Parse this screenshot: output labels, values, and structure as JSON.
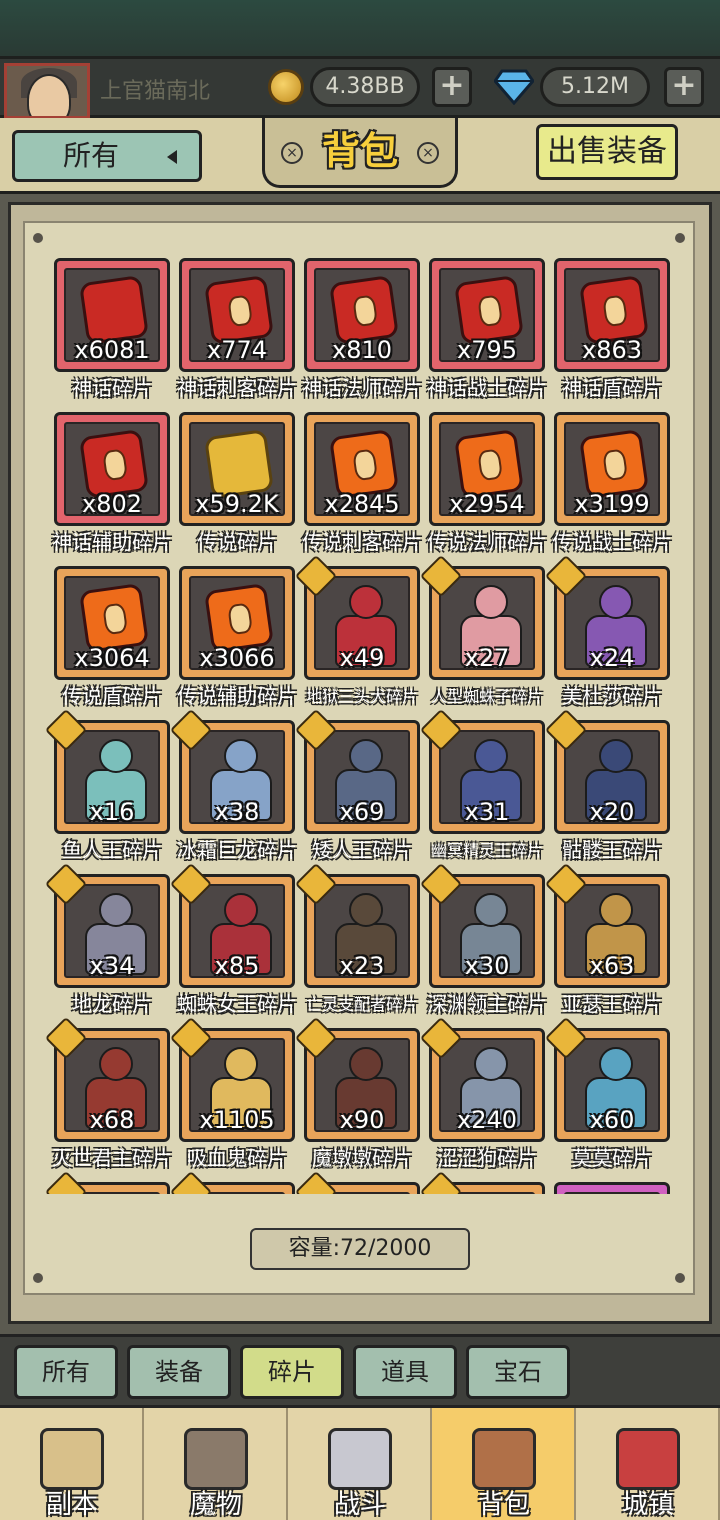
{
  "header": {
    "username": "上官猫南北",
    "gold": "4.38BB",
    "gems": "5.12M",
    "plus": "+"
  },
  "toolbar": {
    "filter_label": "所有",
    "title": "背包",
    "sell_label": "出售装备"
  },
  "inventory": {
    "items": [
      {
        "name": "神话碎片",
        "count": "x6081",
        "rarity": "mythic",
        "kind": "piece",
        "color": "red"
      },
      {
        "name": "神话刺客碎片",
        "count": "x774",
        "rarity": "mythic",
        "kind": "piece",
        "color": "red"
      },
      {
        "name": "神话法师碎片",
        "count": "x810",
        "rarity": "mythic",
        "kind": "piece",
        "color": "red"
      },
      {
        "name": "神话战士碎片",
        "count": "x795",
        "rarity": "mythic",
        "kind": "piece",
        "color": "red"
      },
      {
        "name": "神话盾碎片",
        "count": "x863",
        "rarity": "mythic",
        "kind": "piece",
        "color": "red"
      },
      {
        "name": "神话辅助碎片",
        "count": "x802",
        "rarity": "mythic",
        "kind": "piece",
        "color": "red"
      },
      {
        "name": "传说碎片",
        "count": "x59.2K",
        "rarity": "legend",
        "kind": "piece",
        "color": "gold"
      },
      {
        "name": "传说刺客碎片",
        "count": "x2845",
        "rarity": "legend",
        "kind": "piece",
        "color": "orange"
      },
      {
        "name": "传说法师碎片",
        "count": "x2954",
        "rarity": "legend",
        "kind": "piece",
        "color": "orange"
      },
      {
        "name": "传说战士碎片",
        "count": "x3199",
        "rarity": "legend",
        "kind": "piece",
        "color": "orange"
      },
      {
        "name": "传说盾碎片",
        "count": "x3064",
        "rarity": "legend",
        "kind": "piece",
        "color": "orange"
      },
      {
        "name": "传说辅助碎片",
        "count": "x3066",
        "rarity": "legend",
        "kind": "piece",
        "color": "orange"
      },
      {
        "name": "地狱三头犬碎片",
        "count": "x49",
        "rarity": "legend",
        "kind": "hero",
        "color": "#c2303a"
      },
      {
        "name": "人型蜘蛛子碎片",
        "count": "x27",
        "rarity": "legend",
        "kind": "hero",
        "color": "#e8a0a8"
      },
      {
        "name": "美杜莎碎片",
        "count": "x24",
        "rarity": "legend",
        "kind": "hero",
        "color": "#8a5ab8"
      },
      {
        "name": "鱼人王碎片",
        "count": "x16",
        "rarity": "legend",
        "kind": "hero",
        "color": "#7ec6c2"
      },
      {
        "name": "冰霜巨龙碎片",
        "count": "x38",
        "rarity": "legend",
        "kind": "hero",
        "color": "#8aa8d0"
      },
      {
        "name": "矮人王碎片",
        "count": "x69",
        "rarity": "legend",
        "kind": "hero",
        "color": "#5a6a8a"
      },
      {
        "name": "幽冥精灵王碎片",
        "count": "x31",
        "rarity": "legend",
        "kind": "hero",
        "color": "#4a5a9a"
      },
      {
        "name": "骷髅王碎片",
        "count": "x20",
        "rarity": "legend",
        "kind": "hero",
        "color": "#3a4a7a"
      },
      {
        "name": "地龙碎片",
        "count": "x34",
        "rarity": "legend",
        "kind": "hero",
        "color": "#8a8aa0"
      },
      {
        "name": "蜘蛛女王碎片",
        "count": "x85",
        "rarity": "legend",
        "kind": "hero",
        "color": "#b0303a"
      },
      {
        "name": "亡灵支配者碎片",
        "count": "x23",
        "rarity": "legend",
        "kind": "hero",
        "color": "#5a4a3a"
      },
      {
        "name": "深渊领主碎片",
        "count": "x30",
        "rarity": "legend",
        "kind": "hero",
        "color": "#7a8a9a"
      },
      {
        "name": "亚瑟王碎片",
        "count": "x63",
        "rarity": "legend",
        "kind": "hero",
        "color": "#c89a4a"
      },
      {
        "name": "灭世君主碎片",
        "count": "x68",
        "rarity": "legend",
        "kind": "hero",
        "color": "#9a3a30"
      },
      {
        "name": "吸血鬼碎片",
        "count": "x1105",
        "rarity": "legend",
        "kind": "hero",
        "color": "#e8c060"
      },
      {
        "name": "魔墩墩碎片",
        "count": "x90",
        "rarity": "legend",
        "kind": "hero",
        "color": "#6a3a30"
      },
      {
        "name": "涩涩狗碎片",
        "count": "x240",
        "rarity": "legend",
        "kind": "hero",
        "color": "#8a9ab0"
      },
      {
        "name": "莫莫碎片",
        "count": "x60",
        "rarity": "legend",
        "kind": "hero",
        "color": "#5aa8c8"
      },
      {
        "name": "",
        "count": "",
        "rarity": "legend",
        "kind": "hero",
        "color": "#6a5a4a"
      },
      {
        "name": "",
        "count": "",
        "rarity": "legend",
        "kind": "hero",
        "color": "#6a5a4a"
      },
      {
        "name": "",
        "count": "",
        "rarity": "legend",
        "kind": "hero",
        "color": "#6a5a4a"
      },
      {
        "name": "",
        "count": "",
        "rarity": "legend",
        "kind": "hero",
        "color": "#6a5a4a"
      },
      {
        "name": "",
        "count": "",
        "rarity": "pink",
        "kind": "empty",
        "color": "#6a5a4a"
      }
    ]
  },
  "capacity": "容量:72/2000",
  "category_tabs": [
    {
      "label": "所有",
      "active": false
    },
    {
      "label": "装备",
      "active": false
    },
    {
      "label": "碎片",
      "active": true
    },
    {
      "label": "道具",
      "active": false
    },
    {
      "label": "宝石",
      "active": false
    }
  ],
  "bottom_nav": [
    {
      "label": "副本",
      "icon": "map-icon",
      "active": false,
      "color": "#d8c08a"
    },
    {
      "label": "魔物",
      "icon": "monster-helmet-icon",
      "active": false,
      "color": "#8a7a6a"
    },
    {
      "label": "战斗",
      "icon": "crossed-swords-icon",
      "active": false,
      "color": "#c8c8d0"
    },
    {
      "label": "背包",
      "icon": "backpack-icon",
      "active": true,
      "color": "#b07048"
    },
    {
      "label": "城镇",
      "icon": "town-shop-icon",
      "active": false,
      "color": "#c84040"
    }
  ],
  "colors": {
    "mythic_frame": "#e2646c",
    "legend_frame": "#e9a45a",
    "active_tab": "#d2dc8a",
    "title_gold": "#f7cf3c"
  }
}
